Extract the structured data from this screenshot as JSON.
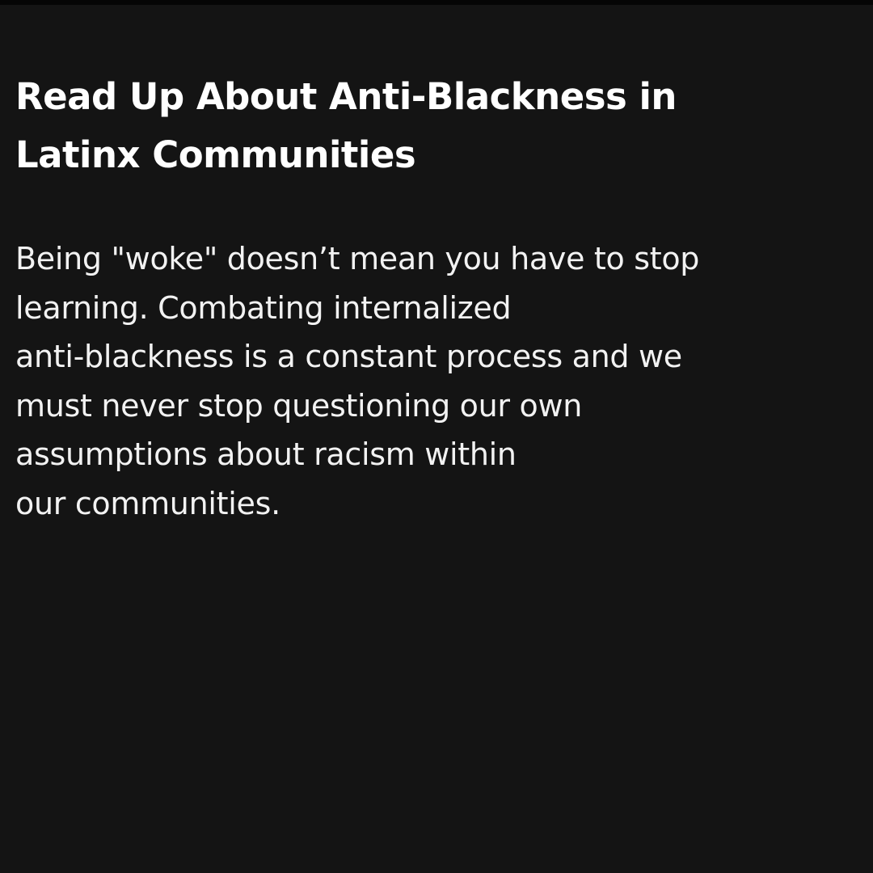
{
  "colors": {
    "background": "#141414",
    "text": "#ffffff"
  },
  "post": {
    "title_lines": [
      "Read Up About Anti-Blackness in",
      "Latinx Communities"
    ],
    "body_lines": [
      "Being \"woke\" doesn’t mean you have to stop",
      "learning. Combating internalized",
      "anti-blackness is a constant process and we",
      "must never stop questioning our own",
      "assumptions about racism within",
      "our communities."
    ]
  }
}
